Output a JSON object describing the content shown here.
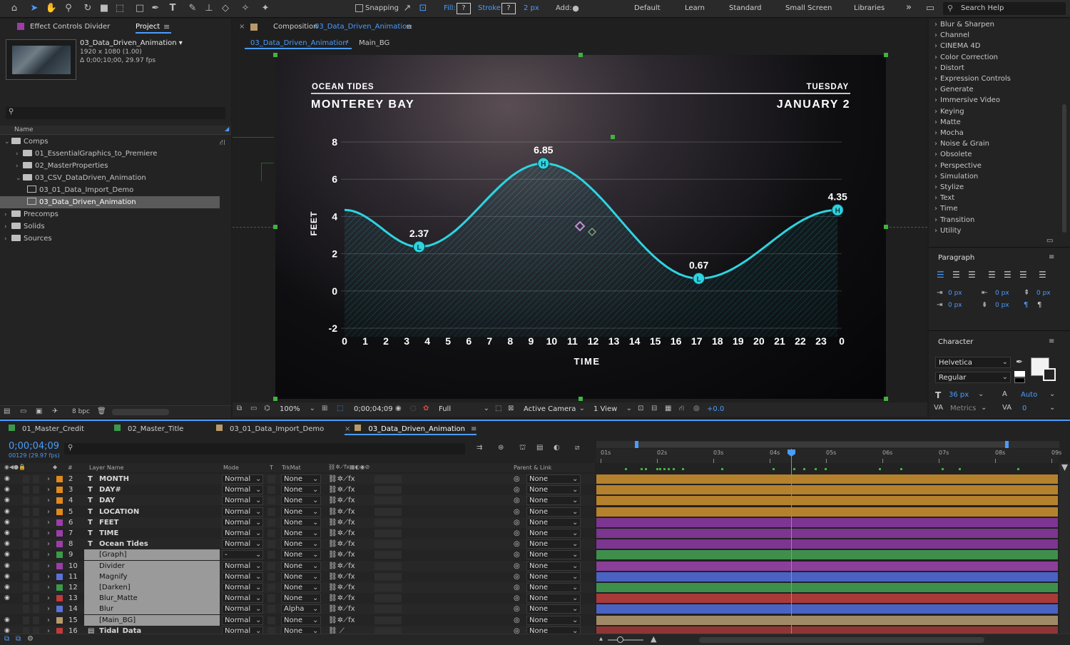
{
  "toolbar": {
    "snapping": "Snapping",
    "fill": "Fill:",
    "fill_q": "?",
    "stroke": "Stroke:",
    "stroke_q": "?",
    "stroke_px": "2 px",
    "add": "Add:",
    "workspaces": [
      "Default",
      "Learn",
      "Standard",
      "Small Screen",
      "Libraries"
    ],
    "search": "Search Help",
    "more": "»"
  },
  "project": {
    "tab_effect": "Effect Controls Divider",
    "tab_project": "Project",
    "comp_name": "03_Data_Driven_Animation ▾",
    "comp_res": "1920 x 1080 (1.00)",
    "comp_dur": "Δ 0;00;10;00, 29.97 fps",
    "col_name": "Name",
    "bpc": "8 bpc",
    "tree": [
      {
        "label": "Comps",
        "indent": 0,
        "open": true,
        "type": "folder"
      },
      {
        "label": "01_EssentialGraphics_to_Premiere",
        "indent": 1,
        "open": false,
        "type": "folder"
      },
      {
        "label": "02_MasterProperties",
        "indent": 1,
        "open": false,
        "type": "folder"
      },
      {
        "label": "03_CSV_DataDriven_Animation",
        "indent": 1,
        "open": true,
        "type": "folder"
      },
      {
        "label": "03_01_Data_Import_Demo",
        "indent": 2,
        "type": "comp"
      },
      {
        "label": "03_Data_Driven_Animation",
        "indent": 2,
        "type": "comp",
        "selected": true
      },
      {
        "label": "Precomps",
        "indent": 0,
        "open": false,
        "type": "folder"
      },
      {
        "label": "Solids",
        "indent": 0,
        "open": false,
        "type": "folder"
      },
      {
        "label": "Sources",
        "indent": 0,
        "open": false,
        "type": "folder"
      }
    ]
  },
  "comp": {
    "tab_prefix": "Composition",
    "tab_name": "03_Data_Driven_Animation",
    "crumb1": "03_Data_Driven_Animation",
    "crumb2": "Main_BG",
    "zoom": "100%",
    "timecode": "0;00;04;09",
    "resolution": "Full",
    "camera": "Active Camera",
    "views": "1 View",
    "offset": "+0.0"
  },
  "chart_data": {
    "type": "area",
    "header_left_small": "OCEAN TIDES",
    "header_left_big": "MONTEREY BAY",
    "header_right_small": "TUESDAY",
    "header_right_big": "JANUARY 2",
    "ylabel": "FEET",
    "xlabel": "TIME",
    "ylim": [
      -2,
      8
    ],
    "yticks": [
      -2,
      0,
      2,
      4,
      6,
      8
    ],
    "xticks": [
      "0",
      "1",
      "2",
      "3",
      "4",
      "5",
      "6",
      "7",
      "8",
      "9",
      "10",
      "11",
      "12",
      "13",
      "14",
      "15",
      "16",
      "17",
      "18",
      "19",
      "20",
      "21",
      "22",
      "23",
      "0"
    ],
    "points": [
      {
        "x": 0,
        "y": 4.35,
        "label": "",
        "marker": ""
      },
      {
        "x": 3.6,
        "y": 2.37,
        "label": "2.37",
        "marker": "L"
      },
      {
        "x": 9.6,
        "y": 6.85,
        "label": "6.85",
        "marker": "H"
      },
      {
        "x": 17.1,
        "y": 0.67,
        "label": "0.67",
        "marker": "L"
      },
      {
        "x": 23.8,
        "y": 4.35,
        "label": "4.35",
        "marker": "H"
      }
    ]
  },
  "effects": {
    "items": [
      "Blur & Sharpen",
      "Channel",
      "CINEMA 4D",
      "Color Correction",
      "Distort",
      "Expression Controls",
      "Generate",
      "Immersive Video",
      "Keying",
      "Matte",
      "Mocha",
      "Noise & Grain",
      "Obsolete",
      "Perspective",
      "Simulation",
      "Stylize",
      "Text",
      "Time",
      "Transition",
      "Utility"
    ]
  },
  "paragraph": {
    "title": "Paragraph",
    "v1": "0 px",
    "v2": "0 px",
    "v3": "0 px",
    "v4": "0 px",
    "v5": "0 px"
  },
  "character": {
    "title": "Character",
    "font": "Helvetica",
    "style": "Regular",
    "size": "36 px",
    "leading": "Auto",
    "kerning": "Metrics",
    "tracking": "0"
  },
  "timeline": {
    "tabs": [
      {
        "label": "01_Master_Credit",
        "color": "#3a9a4a"
      },
      {
        "label": "02_Master_Title",
        "color": "#3a9a4a"
      },
      {
        "label": "03_01_Data_Import_Demo",
        "color": "#b89a6a"
      },
      {
        "label": "03_Data_Driven_Animation",
        "color": "#b89a6a"
      }
    ],
    "timecode": "0;00;04;09",
    "frames": "00129 (29.97 fps)",
    "col_layer": "Layer Name",
    "col_mode": "Mode",
    "col_t": "T",
    "col_trkmat": "TrkMat",
    "col_parent": "Parent & Link",
    "ruler": [
      "01s",
      "02s",
      "03s",
      "04s",
      "05s",
      "06s",
      "07s",
      "08s",
      "09s"
    ],
    "layers": [
      {
        "num": "2",
        "name": "MONTH",
        "type": "T",
        "mode": "Normal",
        "trk": "None",
        "parent": "None",
        "label": "#e08a1e",
        "bar": "#b5812d"
      },
      {
        "num": "3",
        "name": "DAY#",
        "type": "T",
        "mode": "Normal",
        "trk": "None",
        "parent": "None",
        "label": "#e08a1e",
        "bar": "#b5812d"
      },
      {
        "num": "4",
        "name": "DAY",
        "type": "T",
        "mode": "Normal",
        "trk": "None",
        "parent": "None",
        "label": "#e08a1e",
        "bar": "#b5812d"
      },
      {
        "num": "5",
        "name": "LOCATION",
        "type": "T",
        "mode": "Normal",
        "trk": "None",
        "parent": "None",
        "label": "#e08a1e",
        "bar": "#b5812d"
      },
      {
        "num": "6",
        "name": "FEET",
        "type": "T",
        "mode": "Normal",
        "trk": "None",
        "parent": "None",
        "label": "#9b3ea8",
        "bar": "#7c3590"
      },
      {
        "num": "7",
        "name": "TIME",
        "type": "T",
        "mode": "Normal",
        "trk": "None",
        "parent": "None",
        "label": "#9b3ea8",
        "bar": "#7c3590"
      },
      {
        "num": "8",
        "name": "Ocean Tides",
        "type": "T",
        "mode": "Normal",
        "trk": "None",
        "parent": "None",
        "label": "#9b3ea8",
        "bar": "#7c3590"
      },
      {
        "num": "9",
        "name": "[Graph]",
        "type": "comp",
        "mode": "-",
        "trk": "None",
        "parent": "None",
        "label": "#3a9a4a",
        "bar": "#3f8f4c",
        "sel": true
      },
      {
        "num": "10",
        "name": "Divider",
        "type": "star",
        "mode": "Normal",
        "trk": "None",
        "parent": "None",
        "label": "#9b3ea8",
        "bar": "#8a3f99",
        "sel": true
      },
      {
        "num": "11",
        "name": "Magnify",
        "type": "star",
        "mode": "Normal",
        "trk": "None",
        "parent": "None",
        "label": "#5a72d8",
        "bar": "#4a62c2",
        "sel": true
      },
      {
        "num": "12",
        "name": "[Darken]",
        "type": "comp",
        "mode": "Normal",
        "trk": "None",
        "parent": "None",
        "label": "#3a9a4a",
        "bar": "#3f8f4c",
        "sel": true
      },
      {
        "num": "13",
        "name": "Blur_Matte",
        "type": "star",
        "mode": "Normal",
        "trk": "None",
        "parent": "None",
        "label": "#c23a3a",
        "bar": "#a83a3a",
        "sel": true
      },
      {
        "num": "14",
        "name": "Blur",
        "type": "star",
        "mode": "Normal",
        "trk": "Alpha",
        "parent": "None",
        "label": "#5a72d8",
        "bar": "#4a62c2",
        "sel": true
      },
      {
        "num": "15",
        "name": "[Main_BG]",
        "type": "comp",
        "mode": "Normal",
        "trk": "None",
        "parent": "None",
        "label": "#b89a6a",
        "bar": "#a08a66",
        "sel": true
      },
      {
        "num": "16",
        "name": "Tidal_Data",
        "type": "doc",
        "mode": "Normal",
        "trk": "None",
        "parent": "None",
        "label": "#c23a3a",
        "bar": "#8e3636"
      }
    ]
  }
}
